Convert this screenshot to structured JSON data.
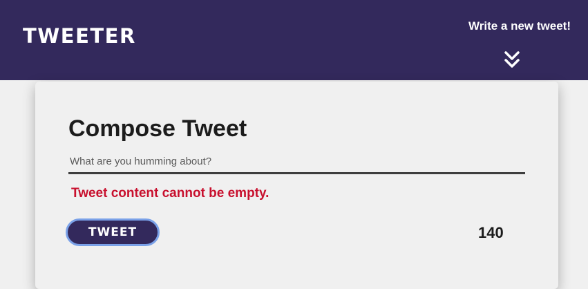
{
  "nav": {
    "brand": "TWEETER",
    "compose_link": "Write a new tweet!",
    "toggle_icon": "double-chevron-down-icon"
  },
  "compose": {
    "title": "Compose Tweet",
    "placeholder": "What are you humming about?",
    "value": "",
    "error": "Tweet content cannot be empty.",
    "submit_label": "TWEET",
    "char_counter": "140"
  },
  "colors": {
    "nav_bg": "#33295c",
    "page_bg": "#f0f0f0",
    "error": "#c8102e",
    "button_border": "#7aa1e8"
  }
}
